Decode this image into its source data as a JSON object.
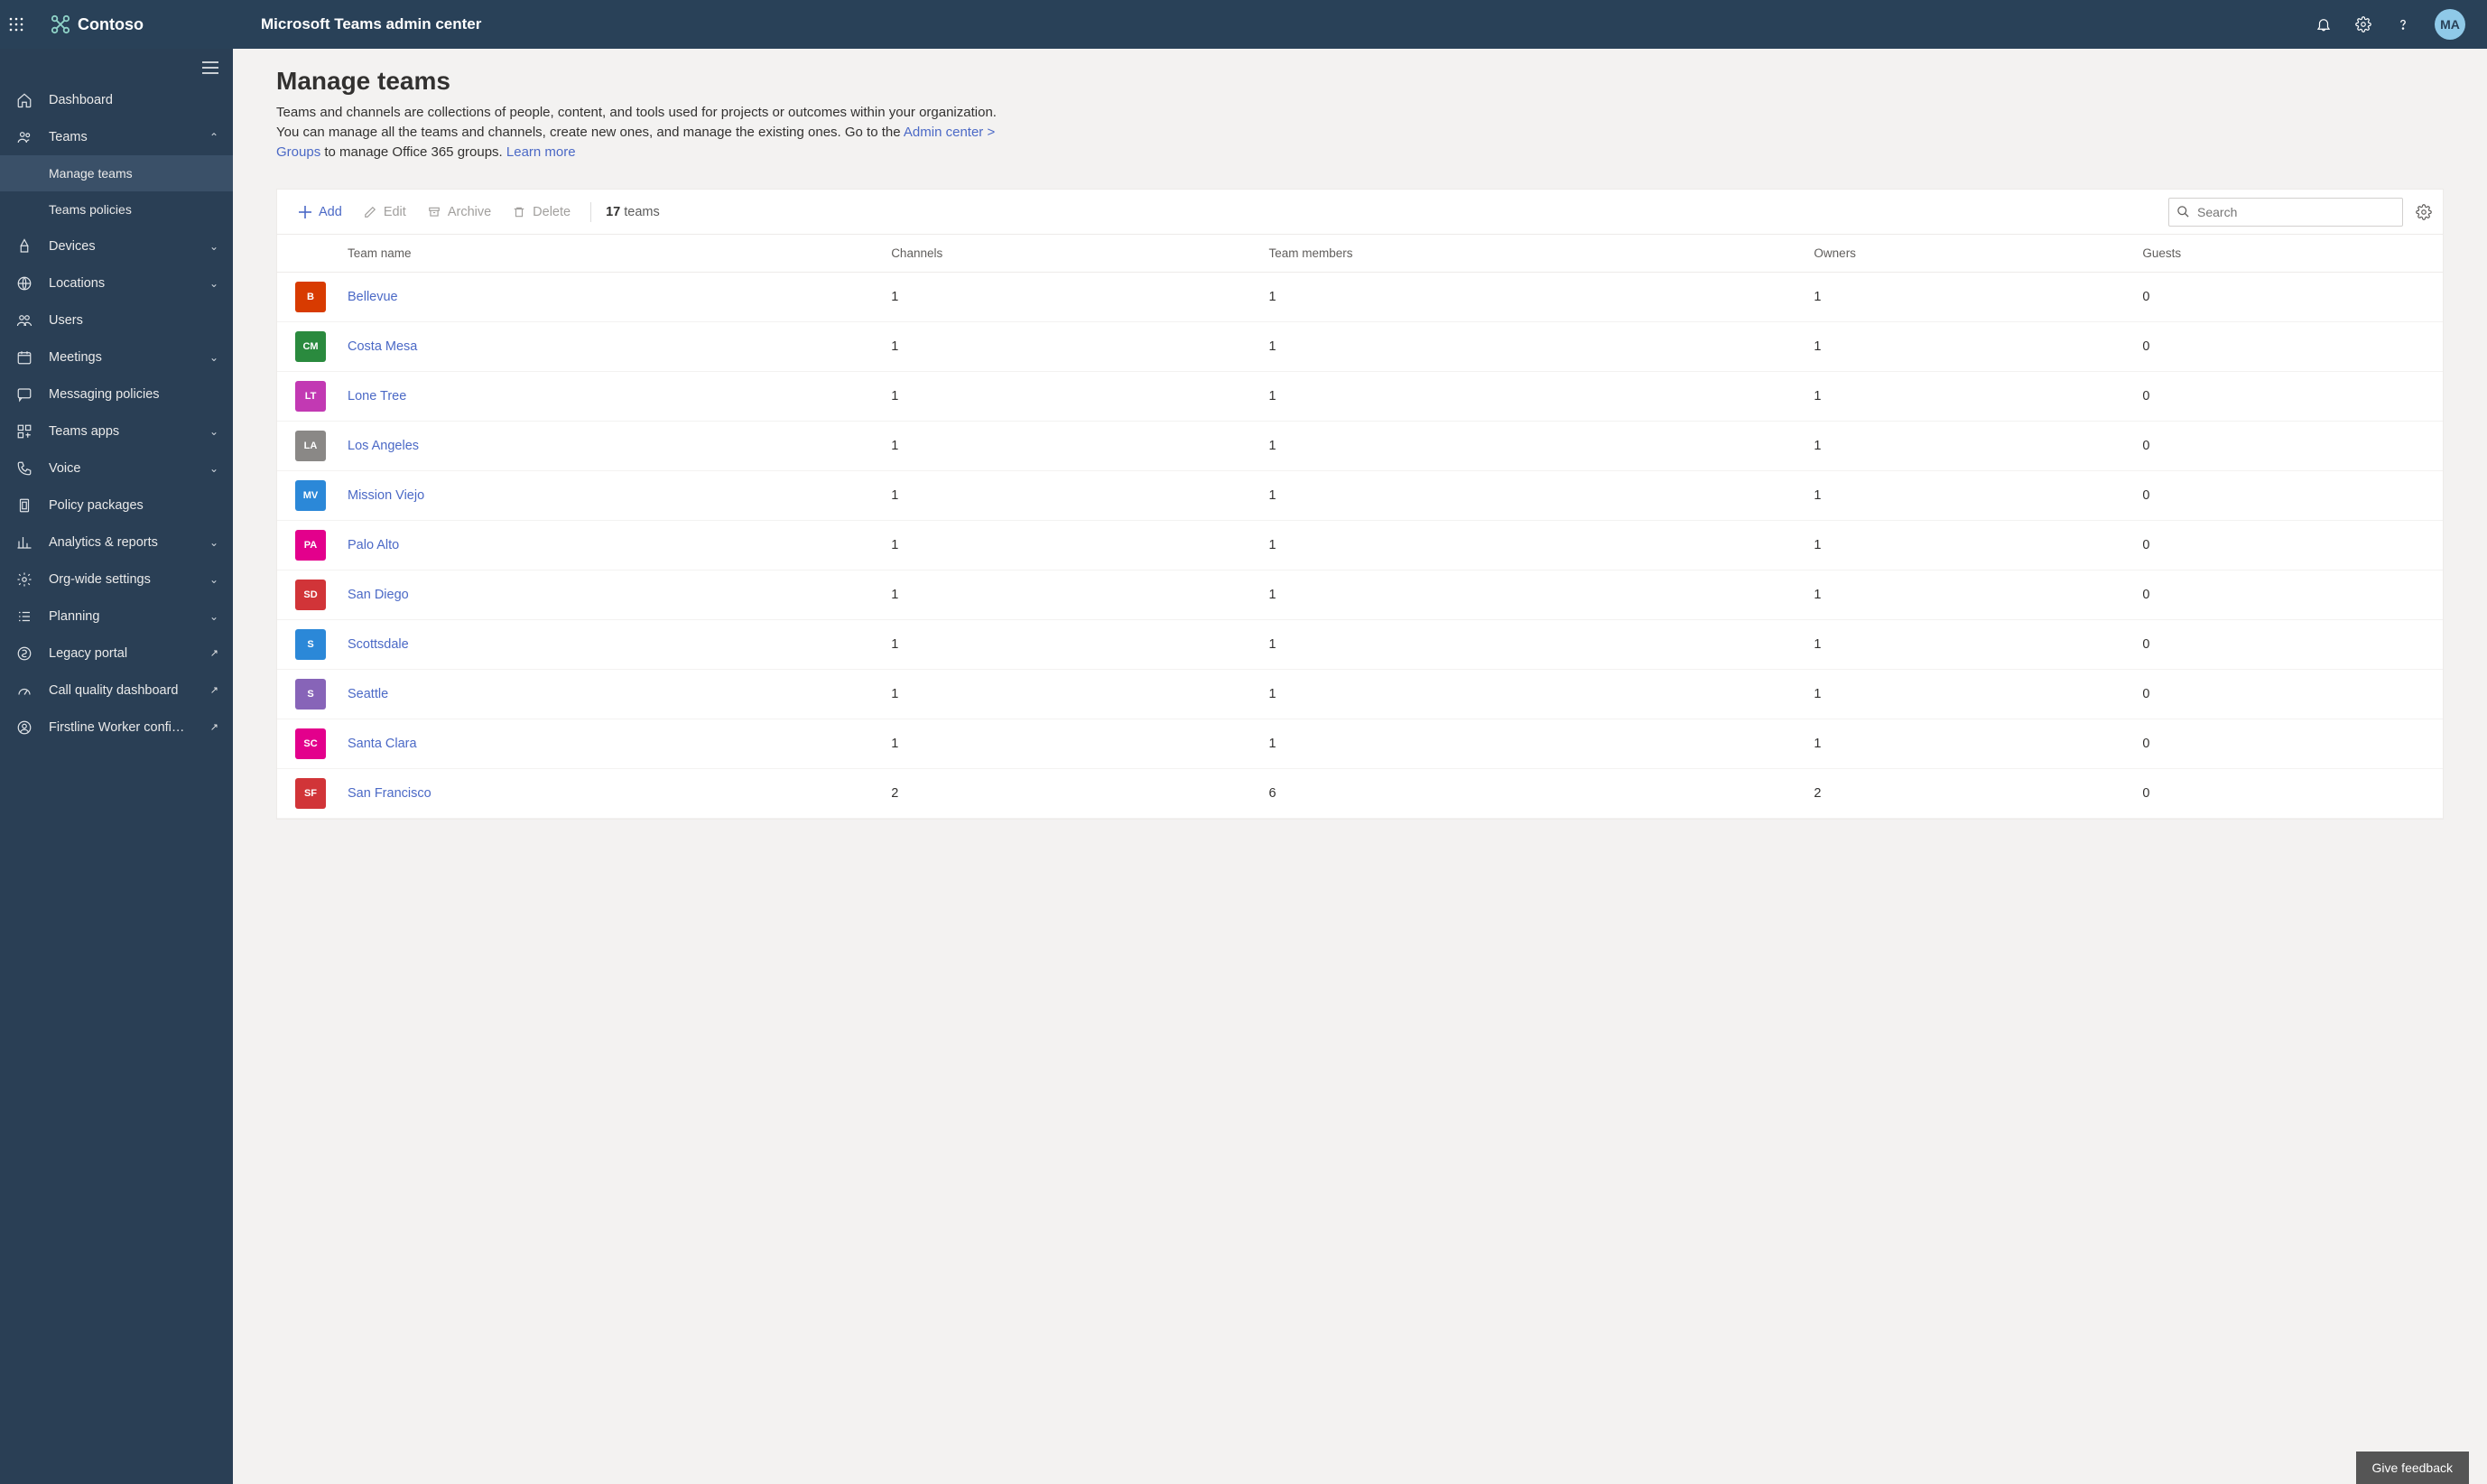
{
  "header": {
    "brand": "Contoso",
    "title": "Microsoft Teams admin center",
    "avatar_initials": "MA"
  },
  "sidebar": {
    "items": [
      {
        "label": "Dashboard",
        "icon": "home",
        "expandable": false
      },
      {
        "label": "Teams",
        "icon": "people",
        "expandable": true,
        "expanded": true,
        "children": [
          {
            "label": "Manage teams",
            "active": true
          },
          {
            "label": "Teams policies",
            "active": false
          }
        ]
      },
      {
        "label": "Devices",
        "icon": "device",
        "expandable": true
      },
      {
        "label": "Locations",
        "icon": "globe",
        "expandable": true
      },
      {
        "label": "Users",
        "icon": "users",
        "expandable": false
      },
      {
        "label": "Meetings",
        "icon": "calendar",
        "expandable": true
      },
      {
        "label": "Messaging policies",
        "icon": "chat",
        "expandable": false
      },
      {
        "label": "Teams apps",
        "icon": "apps",
        "expandable": true
      },
      {
        "label": "Voice",
        "icon": "phone",
        "expandable": true
      },
      {
        "label": "Policy packages",
        "icon": "package",
        "expandable": false
      },
      {
        "label": "Analytics & reports",
        "icon": "chart",
        "expandable": true
      },
      {
        "label": "Org-wide settings",
        "icon": "gear",
        "expandable": true
      },
      {
        "label": "Planning",
        "icon": "checklist",
        "expandable": true
      },
      {
        "label": "Legacy portal",
        "icon": "legacy",
        "expandable": false,
        "external": true
      },
      {
        "label": "Call quality dashboard",
        "icon": "gauge",
        "expandable": false,
        "external": true
      },
      {
        "label": "Firstline Worker configu...",
        "icon": "worker",
        "expandable": false,
        "external": true
      }
    ]
  },
  "page": {
    "title": "Manage teams",
    "desc_pre": "Teams and channels are collections of people, content, and tools used for projects or outcomes within your organization. You can manage all the teams and channels, create new ones, and manage the existing ones. Go to the ",
    "desc_link1": "Admin center > Groups",
    "desc_mid": " to manage Office 365 groups. ",
    "desc_link2": "Learn more"
  },
  "toolbar": {
    "add": "Add",
    "edit": "Edit",
    "archive": "Archive",
    "delete": "Delete",
    "count_num": "17",
    "count_label": "teams",
    "search_placeholder": "Search"
  },
  "columns": {
    "name": "Team name",
    "channels": "Channels",
    "members": "Team members",
    "owners": "Owners",
    "guests": "Guests"
  },
  "teams": [
    {
      "initials": "B",
      "color": "#d83b01",
      "name": "Bellevue",
      "channels": "1",
      "members": "1",
      "owners": "1",
      "guests": "0"
    },
    {
      "initials": "CM",
      "color": "#2a8a3e",
      "name": "Costa Mesa",
      "channels": "1",
      "members": "1",
      "owners": "1",
      "guests": "0"
    },
    {
      "initials": "LT",
      "color": "#c239b3",
      "name": "Lone Tree",
      "channels": "1",
      "members": "1",
      "owners": "1",
      "guests": "0"
    },
    {
      "initials": "LA",
      "color": "#8a8886",
      "name": "Los Angeles",
      "channels": "1",
      "members": "1",
      "owners": "1",
      "guests": "0"
    },
    {
      "initials": "MV",
      "color": "#2b88d8",
      "name": "Mission Viejo",
      "channels": "1",
      "members": "1",
      "owners": "1",
      "guests": "0"
    },
    {
      "initials": "PA",
      "color": "#e3008c",
      "name": "Palo Alto",
      "channels": "1",
      "members": "1",
      "owners": "1",
      "guests": "0"
    },
    {
      "initials": "SD",
      "color": "#d13438",
      "name": "San Diego",
      "channels": "1",
      "members": "1",
      "owners": "1",
      "guests": "0"
    },
    {
      "initials": "S",
      "color": "#2b88d8",
      "name": "Scottsdale",
      "channels": "1",
      "members": "1",
      "owners": "1",
      "guests": "0"
    },
    {
      "initials": "S",
      "color": "#8764b8",
      "name": "Seattle",
      "channels": "1",
      "members": "1",
      "owners": "1",
      "guests": "0"
    },
    {
      "initials": "SC",
      "color": "#e3008c",
      "name": "Santa Clara",
      "channels": "1",
      "members": "1",
      "owners": "1",
      "guests": "0"
    },
    {
      "initials": "SF",
      "color": "#d13438",
      "name": "San Francisco",
      "channels": "2",
      "members": "6",
      "owners": "2",
      "guests": "0"
    }
  ],
  "feedback": {
    "label": "Give feedback"
  }
}
